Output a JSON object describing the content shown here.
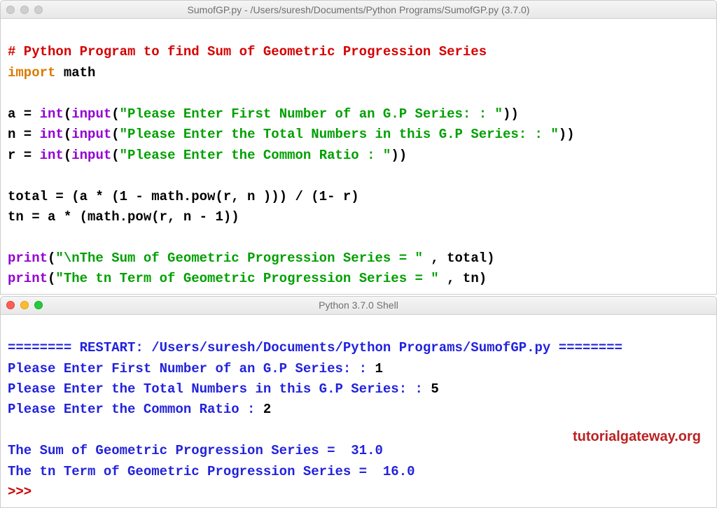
{
  "editor_window": {
    "title": "SumofGP.py - /Users/suresh/Documents/Python Programs/SumofGP.py (3.7.0)",
    "code": {
      "l1_comment": "# Python Program to find Sum of Geometric Progression Series",
      "l2_kw": "import",
      "l2_mod": " math",
      "l4_a": "a = ",
      "l4_int": "int",
      "l4_p1": "(",
      "l4_input": "input",
      "l4_p2": "(",
      "l4_str": "\"Please Enter First Number of an G.P Series: : \"",
      "l4_p3": "))",
      "l5_a": "n = ",
      "l5_int": "int",
      "l5_p1": "(",
      "l5_input": "input",
      "l5_p2": "(",
      "l5_str": "\"Please Enter the Total Numbers in this G.P Series: : \"",
      "l5_p3": "))",
      "l6_a": "r = ",
      "l6_int": "int",
      "l6_p1": "(",
      "l6_input": "input",
      "l6_p2": "(",
      "l6_str": "\"Please Enter the Common Ratio : \"",
      "l6_p3": "))",
      "l8": "total = (a * (1 - math.pow(r, n ))) / (1- r)",
      "l9": "tn = a * (math.pow(r, n - 1))",
      "l11_print": "print",
      "l11_p1": "(",
      "l11_str": "\"\\nThe Sum of Geometric Progression Series = \" ",
      "l11_rest": ", total)",
      "l12_print": "print",
      "l12_p1": "(",
      "l12_str": "\"The tn Term of Geometric Progression Series = \" ",
      "l12_rest": ", tn)"
    }
  },
  "shell_window": {
    "title": "Python 3.7.0 Shell",
    "lines": {
      "restart": "======== RESTART: /Users/suresh/Documents/Python Programs/SumofGP.py ========",
      "p1_q": "Please Enter First Number of an G.P Series: : ",
      "p1_a": "1",
      "p2_q": "Please Enter the Total Numbers in this G.P Series: : ",
      "p2_a": "5",
      "p3_q": "Please Enter the Common Ratio : ",
      "p3_a": "2",
      "blank": "",
      "r1": "The Sum of Geometric Progression Series =  31.0",
      "r2": "The tn Term of Geometric Progression Series =  16.0",
      "prompt": ">>> "
    }
  },
  "watermark": "tutorialgateway.org"
}
